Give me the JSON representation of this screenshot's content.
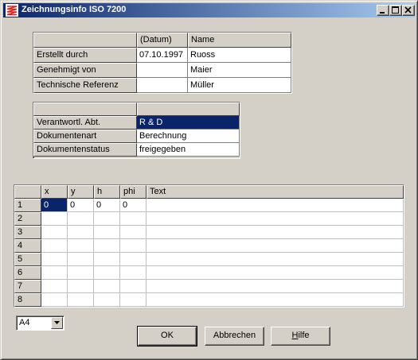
{
  "window": {
    "title": "Zeichnungsinfo ISO 7200",
    "icon": "zigzag-app-icon",
    "buttons": [
      "minimize-icon",
      "maximize-icon",
      "close-icon"
    ]
  },
  "info_table": {
    "headers": [
      "",
      "(Datum)",
      "Name"
    ],
    "rows": [
      {
        "label": "Erstellt durch",
        "date": "07.10.1997",
        "name": "Ruoss"
      },
      {
        "label": "Genehmigt von",
        "date": "",
        "name": "Maier"
      },
      {
        "label": "Technische Referenz",
        "date": "",
        "name": "Müller"
      }
    ]
  },
  "doc_table": {
    "headers": [
      "",
      ""
    ],
    "rows": [
      {
        "label": "Verantwortl. Abt.",
        "value": "R & D",
        "selected": true
      },
      {
        "label": "Dokumentenart",
        "value": "Berechnung",
        "selected": false
      },
      {
        "label": "Dokumentenstatus",
        "value": "freigegeben",
        "selected": false
      }
    ]
  },
  "text_table": {
    "headers": [
      "x",
      "y",
      "h",
      "phi",
      "Text"
    ],
    "rows": [
      {
        "num": "1",
        "x": "0",
        "y": "0",
        "h": "0",
        "phi": "0",
        "text": ""
      },
      {
        "num": "2",
        "x": "",
        "y": "",
        "h": "",
        "phi": "",
        "text": ""
      },
      {
        "num": "3",
        "x": "",
        "y": "",
        "h": "",
        "phi": "",
        "text": ""
      },
      {
        "num": "4",
        "x": "",
        "y": "",
        "h": "",
        "phi": "",
        "text": ""
      },
      {
        "num": "5",
        "x": "",
        "y": "",
        "h": "",
        "phi": "",
        "text": ""
      },
      {
        "num": "6",
        "x": "",
        "y": "",
        "h": "",
        "phi": "",
        "text": ""
      },
      {
        "num": "7",
        "x": "",
        "y": "",
        "h": "",
        "phi": "",
        "text": ""
      },
      {
        "num": "8",
        "x": "",
        "y": "",
        "h": "",
        "phi": "",
        "text": ""
      }
    ]
  },
  "paper_format": {
    "selected": "A4"
  },
  "actions": {
    "ok": "OK",
    "cancel": "Abbrechen",
    "help_accel": "H",
    "help_rest": "ilfe"
  },
  "colors": {
    "titlebar_start": "#0a246a",
    "titlebar_end": "#a6caf0",
    "face": "#d4d0c8",
    "selection": "#0a246a"
  }
}
